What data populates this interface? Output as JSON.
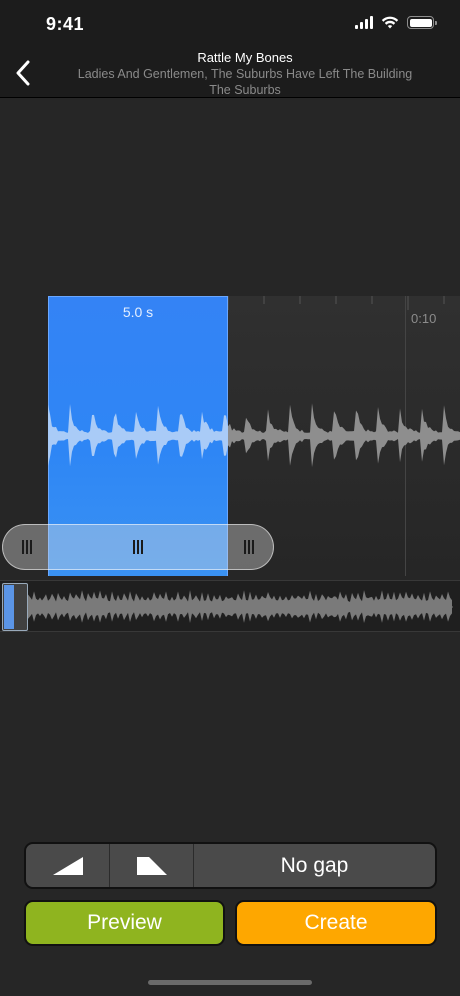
{
  "status": {
    "time": "9:41"
  },
  "nav": {
    "title": "Rattle My Bones",
    "subtitle_line1": "Ladies And Gentlemen, The Suburbs Have Left The Building",
    "subtitle_line2": "The Suburbs"
  },
  "editor": {
    "selection_duration": "5.0 s",
    "time_marker": "0:10"
  },
  "controls": {
    "fade_in_icon": "fade-in-icon",
    "fade_out_icon": "fade-out-icon",
    "gap_label": "No gap"
  },
  "actions": {
    "preview_label": "Preview",
    "create_label": "Create"
  },
  "colors": {
    "selection": "#2e86f5",
    "preview": "#8fb41f",
    "create": "#fea700",
    "background": "#262626"
  }
}
